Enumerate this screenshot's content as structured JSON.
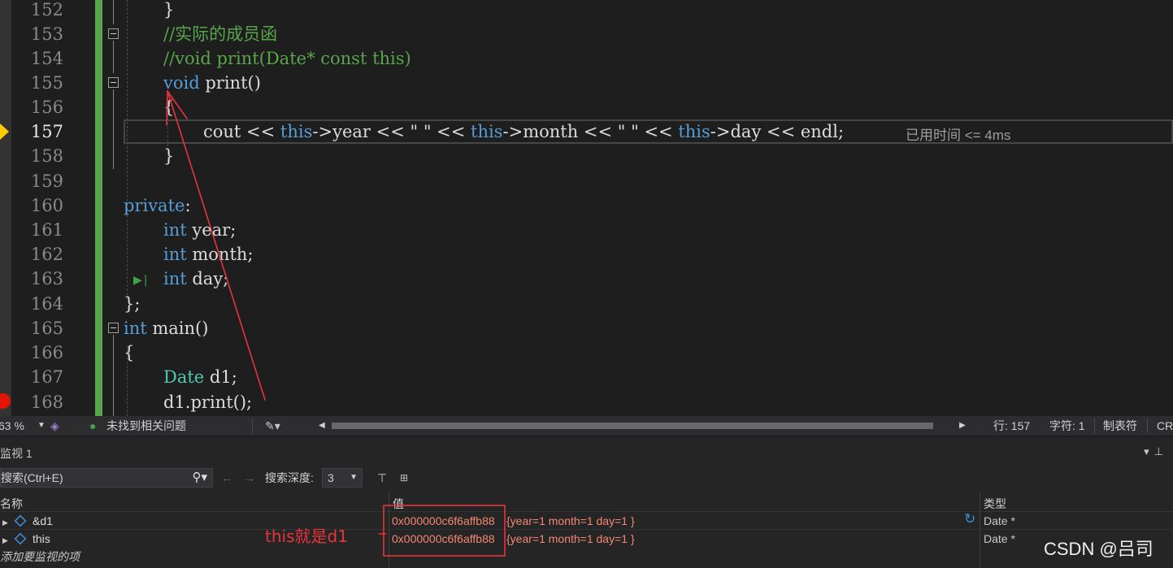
{
  "editor": {
    "line_numbers": [
      "152",
      "153",
      "154",
      "155",
      "156",
      "157",
      "158",
      "159",
      "160",
      "161",
      "162",
      "163",
      "164",
      "165",
      "166",
      "167",
      "168"
    ],
    "current_line": "157",
    "lines": {
      "l152": "}",
      "l153": "//实际的成员函",
      "l154": "//void print(Date* const this)",
      "l155_kw": "void",
      "l155_rest": " print()",
      "l156": "{",
      "l157_a": "cout << ",
      "l157_this1": "this",
      "l157_b": "->year << ",
      "l157_s1": "\" \"",
      "l157_c": " << ",
      "l157_this2": "this",
      "l157_d": "->month << ",
      "l157_s2": "\" \"",
      "l157_e": " << ",
      "l157_this3": "this",
      "l157_f": "->day << endl;",
      "l158": "}",
      "l160_kw": "private",
      "l160_rest": ":",
      "int_kw": "int",
      "l161_rest": " year;",
      "l162_rest": " month;",
      "l163_rest": " day;",
      "l164": "};",
      "l165_rest": " main()",
      "l166": "{",
      "l167_type": "Date",
      "l167_rest": " d1;",
      "l168": "d1.print();"
    },
    "perf_tip": "已用时间 <= 4ms"
  },
  "status_strip": {
    "zoom": "63 %",
    "issues": "未找到相关问题",
    "line": "行: 157",
    "char": "字符: 1",
    "tabs": "制表符",
    "eol": "CR"
  },
  "watch": {
    "title": "监视 1",
    "search_placeholder": "搜索(Ctrl+E)",
    "search_depth_label": "搜索深度:",
    "search_depth_value": "3",
    "columns": {
      "name": "名称",
      "value": "值",
      "type": "类型"
    },
    "rows": [
      {
        "name": "&d1",
        "address": "0x000000c6f6affb88",
        "value": "{year=1 month=1 day=1 }",
        "type": "Date *"
      },
      {
        "name": "this",
        "address": "0x000000c6f6affb88",
        "value": "{year=1 month=1 day=1 }",
        "type": "Date *"
      }
    ],
    "add_item": "添加要监视的项"
  },
  "annotation": {
    "note": "this就是d1"
  },
  "watermark": "CSDN @吕司",
  "colors": {
    "keyword": "#569cd6",
    "comment": "#57a64a",
    "type": "#4ec9b0",
    "annotation": "#e8343a",
    "breakpoint": "#e51400",
    "exec_arrow": "#ffcc00"
  }
}
